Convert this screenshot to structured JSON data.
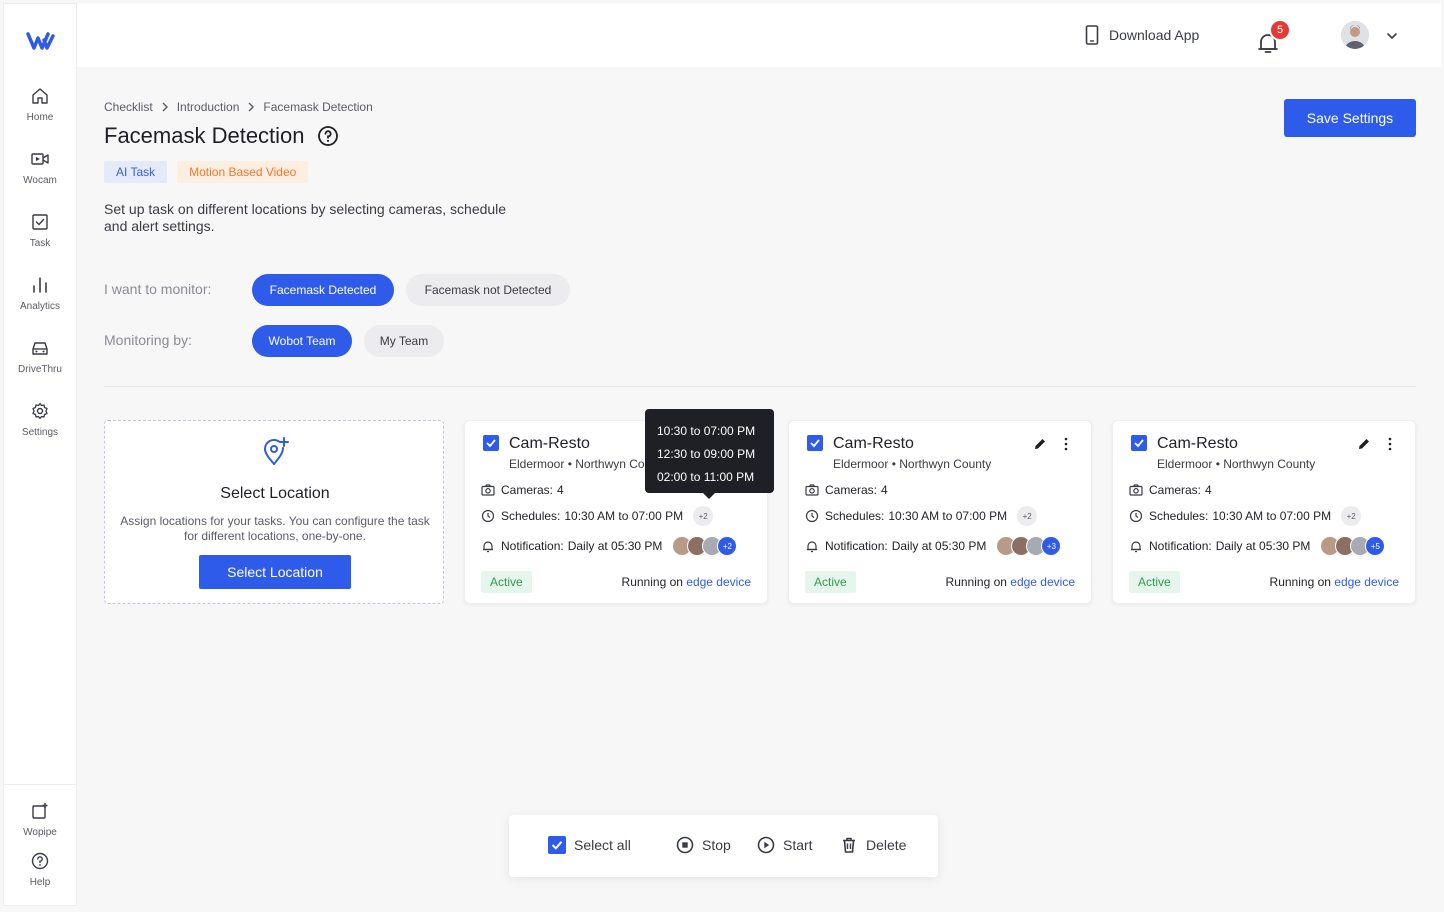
{
  "sidebar": {
    "items": [
      {
        "label": "Home",
        "icon": "home-icon"
      },
      {
        "label": "Wocam",
        "icon": "video-camera-icon"
      },
      {
        "label": "Task",
        "icon": "task-check-icon"
      },
      {
        "label": "Analytics",
        "icon": "bar-chart-icon"
      },
      {
        "label": "DriveThru",
        "icon": "car-icon"
      },
      {
        "label": "Settings",
        "icon": "gear-icon"
      }
    ],
    "bottom": [
      {
        "label": "Wopipe",
        "icon": "wopipe-icon"
      },
      {
        "label": "Help",
        "icon": "help-circle-icon"
      }
    ]
  },
  "topbar": {
    "download_label": "Download App",
    "notification_count": "5"
  },
  "breadcrumb": [
    "Checklist",
    "Introduction",
    "Facemask Detection"
  ],
  "page_title": "Facemask Detection",
  "tags": {
    "ai": "AI Task",
    "motion": "Motion Based Video"
  },
  "description": "Set up task on different locations by selecting cameras, schedule and alert settings.",
  "save_label": "Save Settings",
  "monitor": {
    "label": "I want to monitor:",
    "options": [
      "Facemask Detected",
      "Facemask not Detected"
    ],
    "selected": "Facemask Detected"
  },
  "monitoring_by": {
    "label": "Monitoring by:",
    "options": [
      "Wobot Team",
      "My Team"
    ],
    "selected": "Wobot Team"
  },
  "select_location": {
    "title": "Select Location",
    "description": "Assign locations for your tasks. You can configure the task for different locations, one-by-one.",
    "button": "Select Location"
  },
  "cameras": [
    {
      "name": "Cam-Resto",
      "location": "Eldermoor • Northwyn County",
      "cameras": "Cameras:",
      "cameras_count": "4",
      "schedules": "Schedules:",
      "schedule_value": "10:30 AM to 07:00 PM",
      "schedule_more": "+2",
      "notification": "Notification:",
      "notification_value": "Daily at 05:30 PM",
      "avatars_more": "+2",
      "status": "Active",
      "running_prefix": "Running on",
      "running_link": "edge device"
    },
    {
      "name": "Cam-Resto",
      "location": "Eldermoor • Northwyn County",
      "cameras": "Cameras:",
      "cameras_count": "4",
      "schedules": "Schedules:",
      "schedule_value": "10:30 AM to 07:00 PM",
      "schedule_more": "+2",
      "notification": "Notification:",
      "notification_value": "Daily at 05:30 PM",
      "avatars_more": "+3",
      "status": "Active",
      "running_prefix": "Running on",
      "running_link": "edge device"
    },
    {
      "name": "Cam-Resto",
      "location": "Eldermoor • Northwyn County",
      "cameras": "Cameras:",
      "cameras_count": "4",
      "schedules": "Schedules:",
      "schedule_value": "10:30 AM to 07:00 PM",
      "schedule_more": "+2",
      "notification": "Notification:",
      "notification_value": "Daily at 05:30 PM",
      "avatars_more": "+5",
      "status": "Active",
      "running_prefix": "Running on",
      "running_link": "edge device"
    }
  ],
  "tooltip": [
    "10:30 to 07:00 PM",
    "12:30 to 09:00 PM",
    "02:00 to 11:00 PM"
  ],
  "actions": {
    "select_all": "Select all",
    "stop": "Stop",
    "start": "Start",
    "delete": "Delete"
  },
  "colors": {
    "primary": "#2f5bea",
    "active_bg": "#e7f6ec",
    "active_text": "#2e9b52",
    "badge": "#e53935"
  }
}
